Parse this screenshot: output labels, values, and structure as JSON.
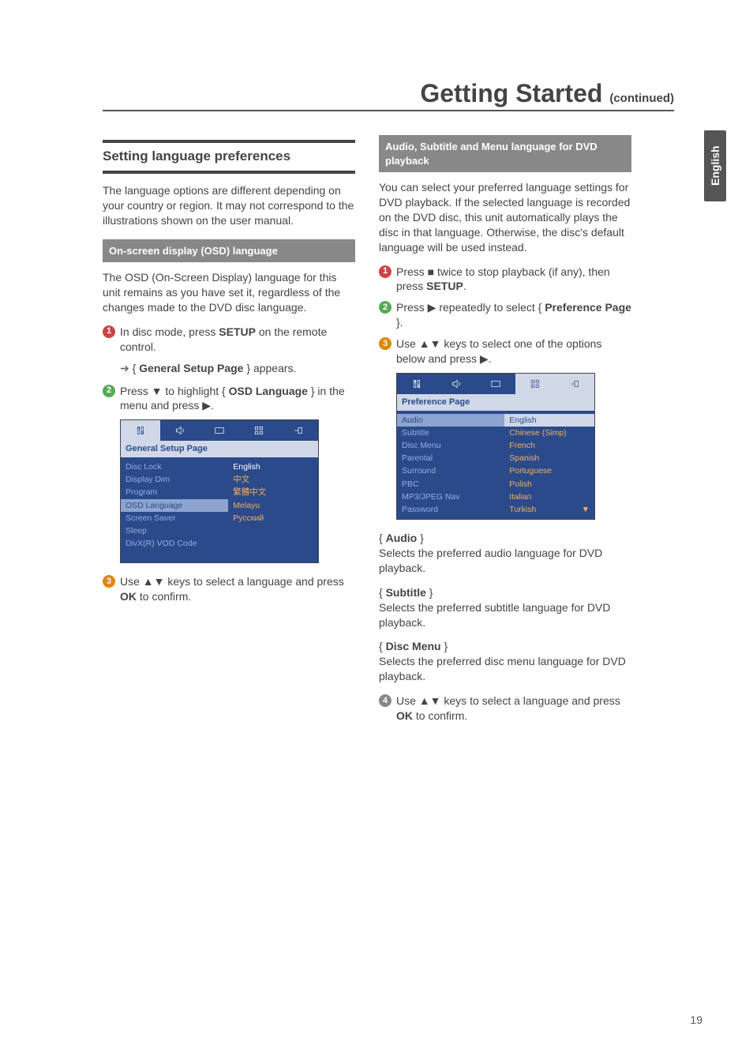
{
  "header": {
    "title": "Getting Started",
    "continued": "(continued)",
    "side_tab": "English"
  },
  "left": {
    "section_title": "Setting language preferences",
    "intro": "The language options are different depending on your country or region. It may not correspond to the illustrations shown on the user manual.",
    "sub_bar": "On-screen display (OSD) language",
    "osd_intro": "The OSD (On-Screen Display) language for this unit remains as you have set it, regardless of the changes made to the DVD disc language.",
    "step1_a": "In disc mode, press ",
    "step1_b": "SETUP",
    "step1_c": " on the remote control.",
    "step1_sub_a": "{ ",
    "step1_sub_b": "General Setup Page",
    "step1_sub_c": " } appears.",
    "step2_a": "Press ▼ to highlight { ",
    "step2_b": "OSD Language",
    "step2_c": " } in the menu and press ▶.",
    "step3_a": "Use ▲▼ keys to select a language and press ",
    "step3_b": "OK",
    "step3_c": " to confirm.",
    "osd_screen": {
      "title": "General Setup Page",
      "left_items": [
        "Disc Lock",
        "Display Dim",
        "Program",
        "OSD Language",
        "Screen Saver",
        "Sleep",
        "DivX(R) VOD Code"
      ],
      "selected_left": "OSD Language",
      "right_items": [
        "English",
        "中文",
        "繁體中文",
        "Melayu",
        "Русский"
      ],
      "selected_right": "English"
    }
  },
  "right": {
    "sub_bar": "Audio, Subtitle and Menu language for DVD playback",
    "intro": "You can select your preferred language settings for DVD playback. If the selected language is recorded on the DVD disc, this unit automatically plays the disc in that language. Otherwise, the disc's default language will be used instead.",
    "step1_a": "Press ■ twice to stop playback (if any), then press ",
    "step1_b": "SETUP",
    "step1_c": ".",
    "step2_a": "Press ▶ repeatedly to select { ",
    "step2_b": "Preference Page",
    "step2_c": " }.",
    "step3": "Use ▲▼ keys to select one of the options below and press ▶.",
    "osd_screen": {
      "title": "Preference Page",
      "left_items": [
        "Audio",
        "Subtitle",
        "Disc Menu",
        "Parental",
        "Surround",
        "PBC",
        "MP3/JPEG Nav",
        "Password"
      ],
      "selected_left": "Audio",
      "right_items": [
        "English",
        "Chinese (Simp)",
        "French",
        "Spanish",
        "Portuguese",
        "Polish",
        "Italian",
        "Turkish"
      ],
      "selected_right": "English"
    },
    "opt1_t": "Audio",
    "opt1_d": "Selects the preferred audio language for DVD playback.",
    "opt2_t": "Subtitle",
    "opt2_d": "Selects the preferred subtitle language for DVD playback.",
    "opt3_t": "Disc Menu",
    "opt3_d": "Selects the preferred disc menu language for DVD playback.",
    "step4_a": "Use ▲▼ keys to select a language and press ",
    "step4_b": "OK",
    "step4_c": " to confirm."
  },
  "page_number": "19"
}
